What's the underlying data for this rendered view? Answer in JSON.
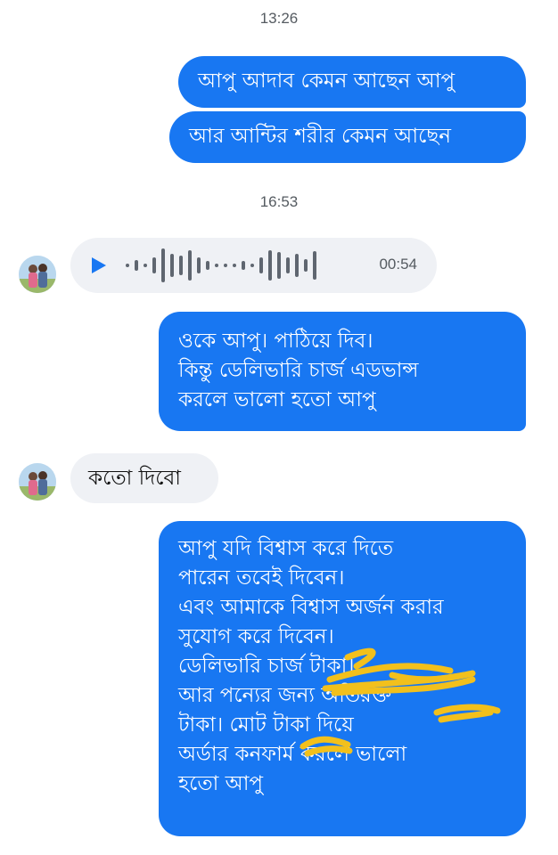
{
  "timestamps": [
    "13:26",
    "16:53"
  ],
  "messages": {
    "m1": "আপু আদাব কেমন আছেন আপু",
    "m2": "আর আন্টির শরীর কেমন আছেন",
    "m3": [
      "ওকে আপু। পাঠিয়ে দিব।",
      "কিন্তু ডেলিভারি চার্জ এডভান্স",
      "করলে ভালো হতো আপু"
    ],
    "m4": "কতো দিবো",
    "m5": [
      "আপু যদি বিশ্বাস করে দিতে",
      "পারেন তবেই দিবেন।",
      "এবং আমাকে বিশ্বাস অর্জন করার",
      "সুযোগ করে দিবেন।",
      "ডেলিভারি চার্জ টাকা।",
      "আর পন্যের জন্য অতিরক্ত",
      "টাকা। মোট টাকা দিয়ে",
      "অর্ডার কনফার্ম করলে ভালো",
      "হতো আপু"
    ]
  },
  "voice": {
    "duration": "00:54",
    "icon": "play-icon"
  },
  "colors": {
    "outgoing": "#1877f2",
    "incoming": "#eff1f5",
    "scribble": "#f2c01c"
  }
}
